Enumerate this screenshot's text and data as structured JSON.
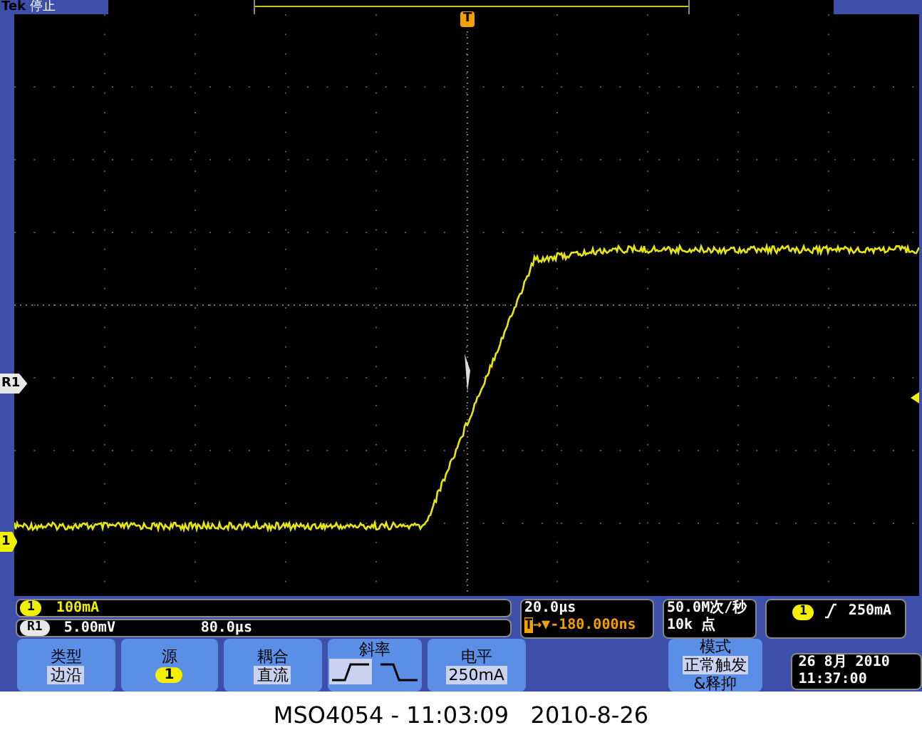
{
  "status": {
    "brand": "Tek",
    "state": "停止"
  },
  "trigger_marker": "T",
  "channel_markers": [
    {
      "label": "R1",
      "kind": "reference"
    },
    {
      "label": "1",
      "kind": "channel"
    }
  ],
  "channel_info": [
    {
      "badge": "1",
      "kind": "channel",
      "scale": "100mA"
    },
    {
      "badge": "R1",
      "kind": "reference",
      "scale": "5.00mV",
      "time": "80.0µs"
    }
  ],
  "timebase": {
    "scale": "20.0µs",
    "badge": "T",
    "arrow": "→▼",
    "delay": "-180.000ns"
  },
  "acquisition": {
    "rate": "50.0M次/秒",
    "points": "10k 点"
  },
  "trigger": {
    "source": "1",
    "level": "250mA"
  },
  "menu_buttons": [
    {
      "kind": "label_value",
      "label": "类型",
      "value": "边沿"
    },
    {
      "kind": "source",
      "label": "源",
      "value": "1"
    },
    {
      "kind": "label_value",
      "label": "耦合",
      "value": "直流"
    },
    {
      "kind": "slope",
      "label": "斜率",
      "options": [
        {
          "kind": "rising",
          "selected": true
        },
        {
          "kind": "falling",
          "selected": false
        }
      ]
    },
    {
      "kind": "label_value",
      "label": "电平",
      "value": "250mA"
    },
    {
      "kind": "mode",
      "label": "模式",
      "value": "正常触发",
      "extra": "&释抑"
    }
  ],
  "clock": {
    "date": "26 8月 2010",
    "time": "11:37:00"
  },
  "caption": "MSO4054 - 11:03:09   2010-8-26"
}
